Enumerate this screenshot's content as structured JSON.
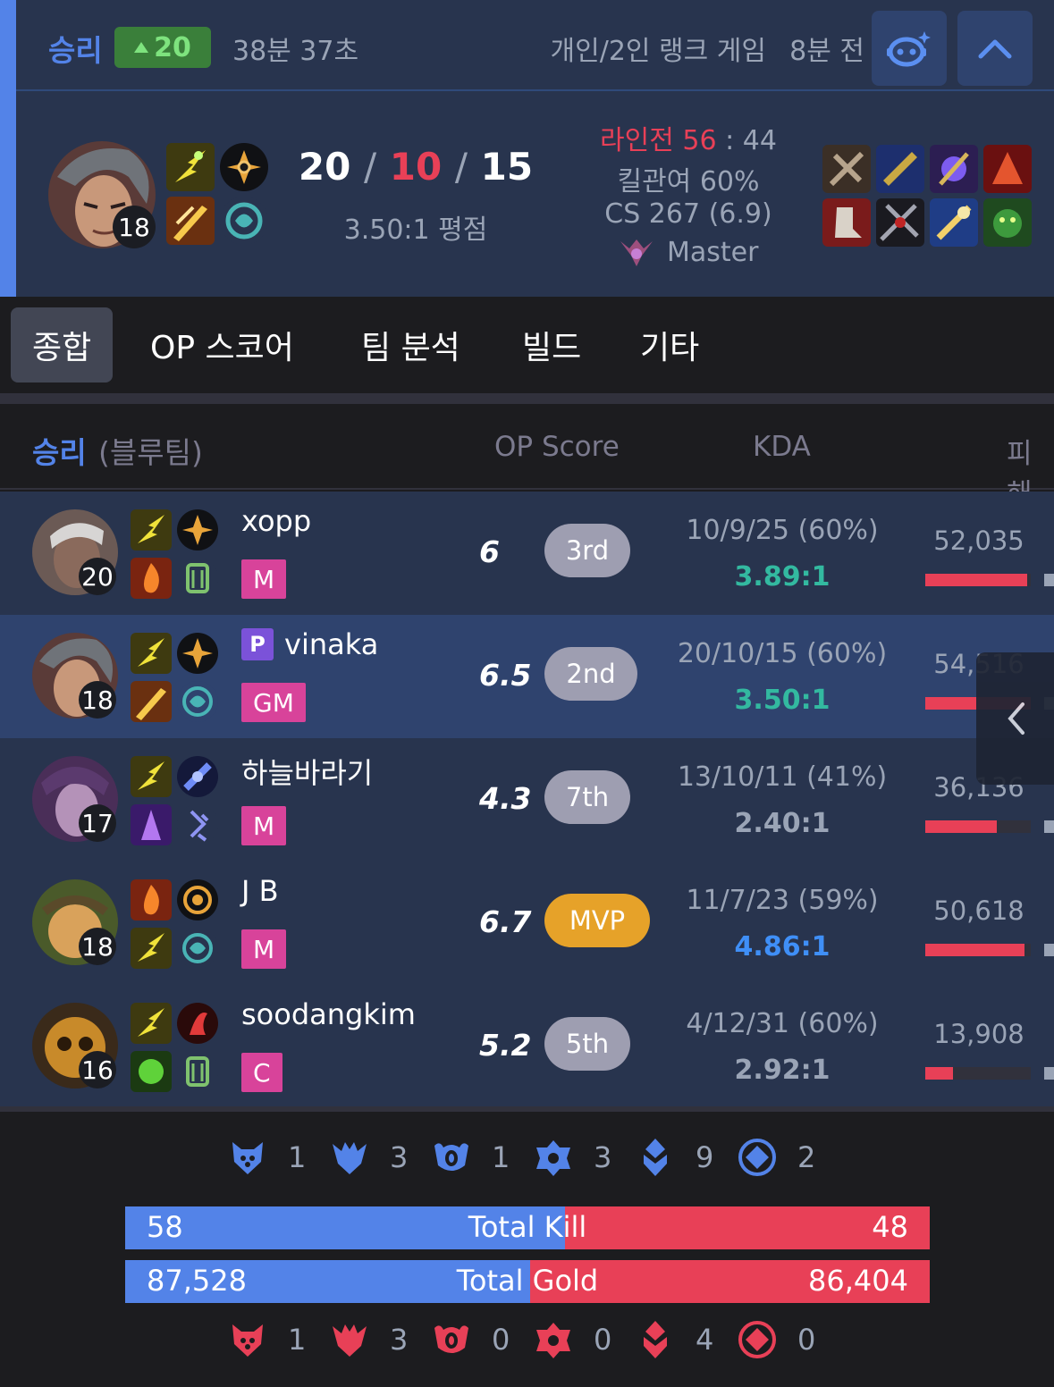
{
  "summary": {
    "result": "승리",
    "lp_change": "20",
    "duration": "38분 37초",
    "queue": "개인/2인 랭크 게임",
    "time_ago": "8분 전",
    "champion_level": "18",
    "kills": "20",
    "deaths": "10",
    "assists": "15",
    "sep": "/",
    "kda_ratio": "3.50:1 평점",
    "laning_label": "라인전",
    "laning_us": "56",
    "laning_colon": ":",
    "laning_them": "44",
    "kill_participation": "킬관여 60%",
    "cs": "CS 267 (6.9)",
    "tier": "Master"
  },
  "tabs": [
    "종합",
    "OP 스코어",
    "팀 분석",
    "빌드",
    "기타"
  ],
  "team": {
    "result": "승리",
    "side": "(블루팀)",
    "columns": {
      "op_score": "OP Score",
      "kda": "KDA",
      "damage": "피해"
    }
  },
  "players": [
    {
      "name": "xopp",
      "tier": "M",
      "level": "20",
      "score": "6",
      "rank": "3rd",
      "kda": "10/9/25 (60%)",
      "ratio": "3.89:1",
      "ratio_color": "#33b9a0",
      "damage": "52,035",
      "damage_frac": 0.97,
      "premium": ""
    },
    {
      "name": "vinaka",
      "tier": "GM",
      "level": "18",
      "score": "6.5",
      "rank": "2nd",
      "kda": "20/10/15 (60%)",
      "ratio": "3.50:1",
      "ratio_color": "#33b9a0",
      "damage": "54,516",
      "damage_frac": 1.0,
      "premium": "P"
    },
    {
      "name": "하늘바라기",
      "tier": "M",
      "level": "17",
      "score": "4.3",
      "rank": "7th",
      "kda": "13/10/11 (41%)",
      "ratio": "2.40:1",
      "ratio_color": "#9aa4b6",
      "damage": "36,136",
      "damage_frac": 0.68,
      "premium": ""
    },
    {
      "name": "J B",
      "tier": "M",
      "level": "18",
      "score": "6.7",
      "rank": "MVP",
      "kda": "11/7/23 (59%)",
      "ratio": "4.86:1",
      "ratio_color": "#3f8ff7",
      "damage": "50,618",
      "damage_frac": 0.94,
      "premium": ""
    },
    {
      "name": "soodangkim",
      "tier": "C",
      "level": "16",
      "score": "5.2",
      "rank": "5th",
      "kda": "4/12/31 (60%)",
      "ratio": "2.92:1",
      "ratio_color": "#9aa4b6",
      "damage": "13,908",
      "damage_frac": 0.26,
      "premium": ""
    }
  ],
  "objectives_blue": {
    "grub": "1",
    "dragon": "3",
    "herald": "1",
    "baron": "3",
    "tower": "9",
    "inhib": "2"
  },
  "objectives_red": {
    "grub": "1",
    "dragon": "3",
    "herald": "0",
    "baron": "0",
    "tower": "4",
    "inhib": "0"
  },
  "total_kill": {
    "label": "Total Kill",
    "blue": "58",
    "red": "48",
    "blue_frac": 0.547
  },
  "total_gold": {
    "label": "Total Gold",
    "blue": "87,528",
    "red": "86,404",
    "blue_frac": 0.503
  },
  "colors": {
    "blue": "#5383e8",
    "red": "#e84057",
    "bg": "#1c1c1f",
    "card": "#28344e",
    "highlight": "#2f436e"
  }
}
